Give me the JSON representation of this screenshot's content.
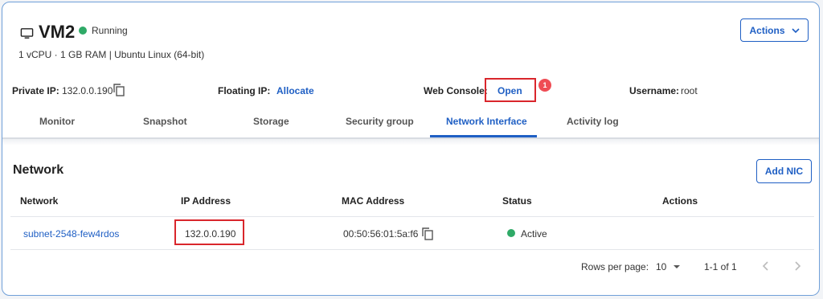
{
  "vm": {
    "name": "VM2",
    "status": "Running",
    "specs": "1 vCPU · 1 GB RAM | Ubuntu Linux (64-bit)",
    "actions_label": "Actions"
  },
  "info": {
    "private_ip_label": "Private IP:",
    "private_ip_value": "132.0.0.190",
    "floating_ip_label": "Floating IP:",
    "floating_ip_action": "Allocate",
    "web_console_label": "Web Console:",
    "web_console_action": "Open",
    "web_console_badge": "1",
    "username_label": "Username:",
    "username_value": "root"
  },
  "tabs": [
    {
      "label": "Monitor",
      "active": false
    },
    {
      "label": "Snapshot",
      "active": false
    },
    {
      "label": "Storage",
      "active": false
    },
    {
      "label": "Security group",
      "active": false
    },
    {
      "label": "Network Interface",
      "active": true
    },
    {
      "label": "Activity log",
      "active": false
    }
  ],
  "network": {
    "title": "Network",
    "add_button": "Add NIC",
    "columns": [
      "Network",
      "IP Address",
      "MAC Address",
      "Status",
      "Actions"
    ],
    "rows": [
      {
        "network": "subnet-2548-few4rdos",
        "ip": "132.0.0.190",
        "mac": "00:50:56:01:5a:f6",
        "status": "Active"
      }
    ],
    "footer": {
      "rows_per_page_label": "Rows per page:",
      "rows_per_page_value": "10",
      "range": "1-1 of 1"
    }
  },
  "colors": {
    "accent": "#1f5fc4",
    "status_green": "#2faa67",
    "highlight_red": "#d9262c",
    "badge_red": "#ef4d55"
  },
  "icons": [
    "monitor-icon",
    "copy-icon",
    "chevron-down-icon",
    "caret-down-icon",
    "chevron-left-icon",
    "chevron-right-icon"
  ]
}
